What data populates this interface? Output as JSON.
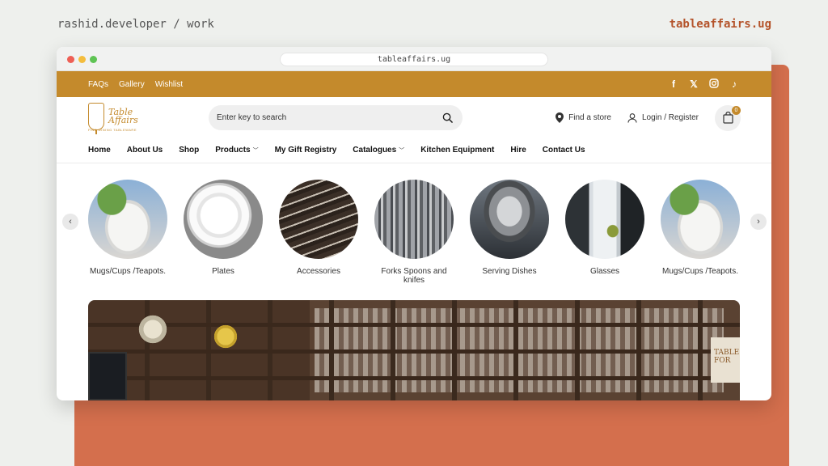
{
  "corner": {
    "left": "rashid.developer / work",
    "right": "tableaffairs.ug"
  },
  "browser": {
    "url": "tableaffairs.ug"
  },
  "topbar": {
    "links": [
      "FAQs",
      "Gallery",
      "Wishlist"
    ],
    "social": [
      "facebook-icon",
      "x-icon",
      "instagram-icon",
      "tiktok-icon"
    ],
    "accent_color": "#c48a2c"
  },
  "logo": {
    "line1": "Table",
    "line2": "Affairs",
    "tagline": "FINE DINING TABLEWARE"
  },
  "search": {
    "placeholder": "Enter key to search"
  },
  "header": {
    "find_store": "Find a store",
    "login": "Login / Register",
    "cart_count": "0"
  },
  "nav": {
    "items": [
      {
        "label": "Home"
      },
      {
        "label": "About Us"
      },
      {
        "label": "Shop"
      },
      {
        "label": "Products",
        "dropdown": true
      },
      {
        "label": "My Gift Registry"
      },
      {
        "label": "Catalogues",
        "dropdown": true
      },
      {
        "label": "Kitchen Equipment"
      },
      {
        "label": "Hire"
      },
      {
        "label": "Contact Us"
      }
    ]
  },
  "categories": [
    {
      "label": "Mugs/Cups /Teapots."
    },
    {
      "label": "Plates"
    },
    {
      "label": "Accessories"
    },
    {
      "label": "Forks Spoons and knifes"
    },
    {
      "label": "Serving Dishes"
    },
    {
      "label": "Glasses"
    },
    {
      "label": "Mugs/Cups /Teapots."
    }
  ],
  "banner": {
    "sign_text": "TABLE FOR"
  }
}
